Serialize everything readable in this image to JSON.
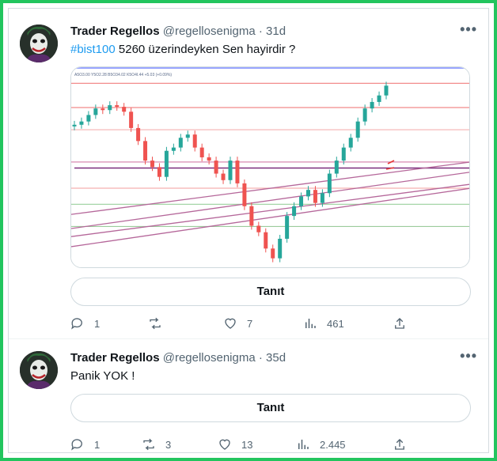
{
  "tweets": [
    {
      "name": "Trader Regellos",
      "handle": "@regellosenigma",
      "dot": "·",
      "time": "31d",
      "hashtag": "#bist100",
      "text": " 5260 üzerindeyken Sen hayirdir ?",
      "translate_label": "Tanıt",
      "replies": "1",
      "retweets": "",
      "likes": "7",
      "views": "461",
      "chart_header": "A5O3.00 Y5O2.28 B5O34.02 K5O4I.44 +5.03 (+0.09%)"
    },
    {
      "name": "Trader Regellos",
      "handle": "@regellosenigma",
      "dot": "·",
      "time": "35d",
      "text": "Panik YOK !",
      "translate_label": "Tanıt",
      "replies": "1",
      "retweets": "3",
      "likes": "13",
      "views": "2.445"
    }
  ],
  "icons": {
    "more": "more-options-icon",
    "reply": "reply-icon",
    "retweet": "retweet-icon",
    "like": "like-icon",
    "views": "views-icon",
    "share": "share-icon"
  },
  "colors": {
    "accent": "#1d9bf0",
    "text_secondary": "#536471",
    "frame": "#22c55e",
    "candle_up": "#26a69a",
    "candle_down": "#ef5350"
  },
  "chart_data": {
    "type": "candlestick",
    "series": [
      {
        "values": [
          5030,
          5040,
          5060,
          5080,
          5075,
          5090,
          5085,
          5070,
          5020,
          4980,
          4920,
          4900,
          4870,
          4950,
          4960,
          4990,
          5000,
          4960,
          4930,
          4920,
          4880,
          4860,
          4920,
          4850,
          4780,
          4720,
          4700,
          4650,
          4620,
          4680,
          4750,
          4780,
          4810,
          4830,
          4790,
          4820,
          4880,
          4920,
          4960,
          4990,
          5040,
          5080,
          5100,
          5120,
          5150
        ]
      }
    ]
  }
}
